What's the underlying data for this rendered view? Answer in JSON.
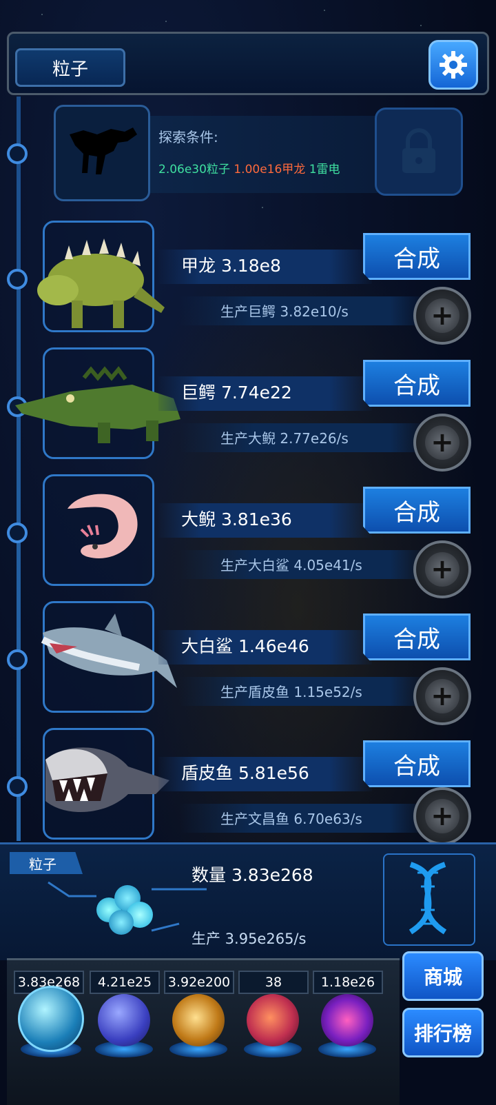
{
  "header": {
    "title": "粒子"
  },
  "locked": {
    "title": "探索条件:",
    "req1": "2.06e30粒子",
    "req2": "1.00e16甲龙",
    "req3": "1雷电",
    "colors": {
      "req1": "#3fe0a0",
      "req2": "#ff6a3c",
      "req3": "#3fe0a0"
    }
  },
  "rows": [
    {
      "name": "甲龙 3.18e8",
      "production": "生产巨鳄 3.82e10/s",
      "merge_label": "合成",
      "icon": "ankylosaurus"
    },
    {
      "name": "巨鳄 7.74e22",
      "production": "生产大鲵 2.77e26/s",
      "merge_label": "合成",
      "icon": "crocodile"
    },
    {
      "name": "大鲵 3.81e36",
      "production": "生产大白鲨 4.05e41/s",
      "merge_label": "合成",
      "icon": "axolotl"
    },
    {
      "name": "大白鲨 1.46e46",
      "production": "生产盾皮鱼 1.15e52/s",
      "merge_label": "合成",
      "icon": "shark"
    },
    {
      "name": "盾皮鱼 5.81e56",
      "production": "生产文昌鱼 6.70e63/s",
      "merge_label": "合成",
      "icon": "dunkleosteus"
    }
  ],
  "particle": {
    "tag": "粒子",
    "count": "数量 3.83e268",
    "production": "生产 3.95e265/s"
  },
  "resources": [
    {
      "value": "3.83e268",
      "icon": "particle-orb",
      "color": "#3ad0ff"
    },
    {
      "value": "4.21e25",
      "icon": "lightning-orb",
      "color": "#5a6dff"
    },
    {
      "value": "3.92e200",
      "icon": "fire-orb",
      "color": "#e0a030"
    },
    {
      "value": "38",
      "icon": "brain-orb",
      "color": "#d04070"
    },
    {
      "value": "1.18e26",
      "icon": "vortex-orb",
      "color": "#a040e0"
    }
  ],
  "side": {
    "shop": "商城",
    "rank": "排行榜"
  }
}
